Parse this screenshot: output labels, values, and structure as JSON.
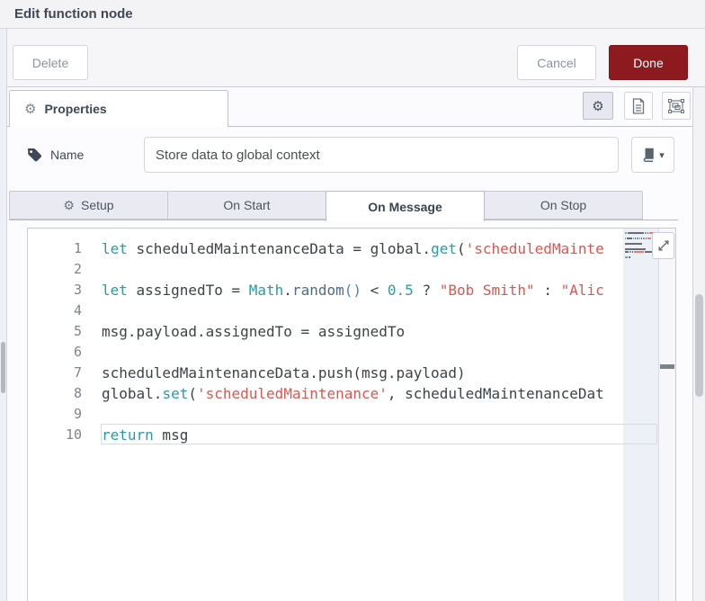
{
  "window": {
    "title": "Edit function node"
  },
  "toolbar": {
    "delete_label": "Delete",
    "cancel_label": "Cancel",
    "done_label": "Done"
  },
  "properties_bar": {
    "tab_label": "Properties"
  },
  "name_row": {
    "label": "Name",
    "value": "Store data to global context"
  },
  "function_tabs": [
    {
      "label": "Setup",
      "icon": "gear",
      "active": false
    },
    {
      "label": "On Start",
      "active": false
    },
    {
      "label": "On Message",
      "active": true
    },
    {
      "label": "On Stop",
      "active": false
    }
  ],
  "editor": {
    "current_line": 10,
    "lines": [
      {
        "num": 1,
        "tokens": [
          [
            "let",
            "kw"
          ],
          [
            " scheduledMaintenanceData = global.",
            "pl"
          ],
          [
            "get",
            "fn"
          ],
          [
            "(",
            "pl"
          ],
          [
            "'scheduledMainte",
            "str"
          ]
        ]
      },
      {
        "num": 2,
        "tokens": []
      },
      {
        "num": 3,
        "tokens": [
          [
            "let",
            "kw"
          ],
          [
            " assignedTo = ",
            "pl"
          ],
          [
            "Math",
            "kw"
          ],
          [
            ".",
            "pl"
          ],
          [
            "random",
            "mth"
          ],
          [
            "()",
            "brk"
          ],
          [
            " < ",
            "pl"
          ],
          [
            "0.5",
            "num"
          ],
          [
            " ? ",
            "pl"
          ],
          [
            "\"Bob Smith\"",
            "str"
          ],
          [
            " : ",
            "pl"
          ],
          [
            "\"Alic",
            "str"
          ]
        ]
      },
      {
        "num": 4,
        "tokens": []
      },
      {
        "num": 5,
        "tokens": [
          [
            "msg.payload.assignedTo = assignedTo",
            "pl"
          ]
        ]
      },
      {
        "num": 6,
        "tokens": []
      },
      {
        "num": 7,
        "tokens": [
          [
            "scheduledMaintenanceData.push(msg.payload)",
            "pl"
          ]
        ]
      },
      {
        "num": 8,
        "tokens": [
          [
            "global.",
            "pl"
          ],
          [
            "set",
            "fn"
          ],
          [
            "(",
            "pl"
          ],
          [
            "'scheduledMaintenance'",
            "str"
          ],
          [
            ", scheduledMaintenanceDat",
            "pl"
          ]
        ]
      },
      {
        "num": 9,
        "tokens": []
      },
      {
        "num": 10,
        "tokens": [
          [
            "return",
            "kw"
          ],
          [
            " msg",
            "pl"
          ]
        ]
      }
    ]
  },
  "colors": {
    "keyword": "#2b9aa5",
    "string": "#e0544e",
    "number": "#2b9aa5",
    "function": "#2b9aa5",
    "method": "#4d6b8a",
    "bracket": "#4a7fd0",
    "plain": "#3b4349",
    "done_button_bg": "#8c1a1e",
    "line_number": "#7d848c"
  }
}
